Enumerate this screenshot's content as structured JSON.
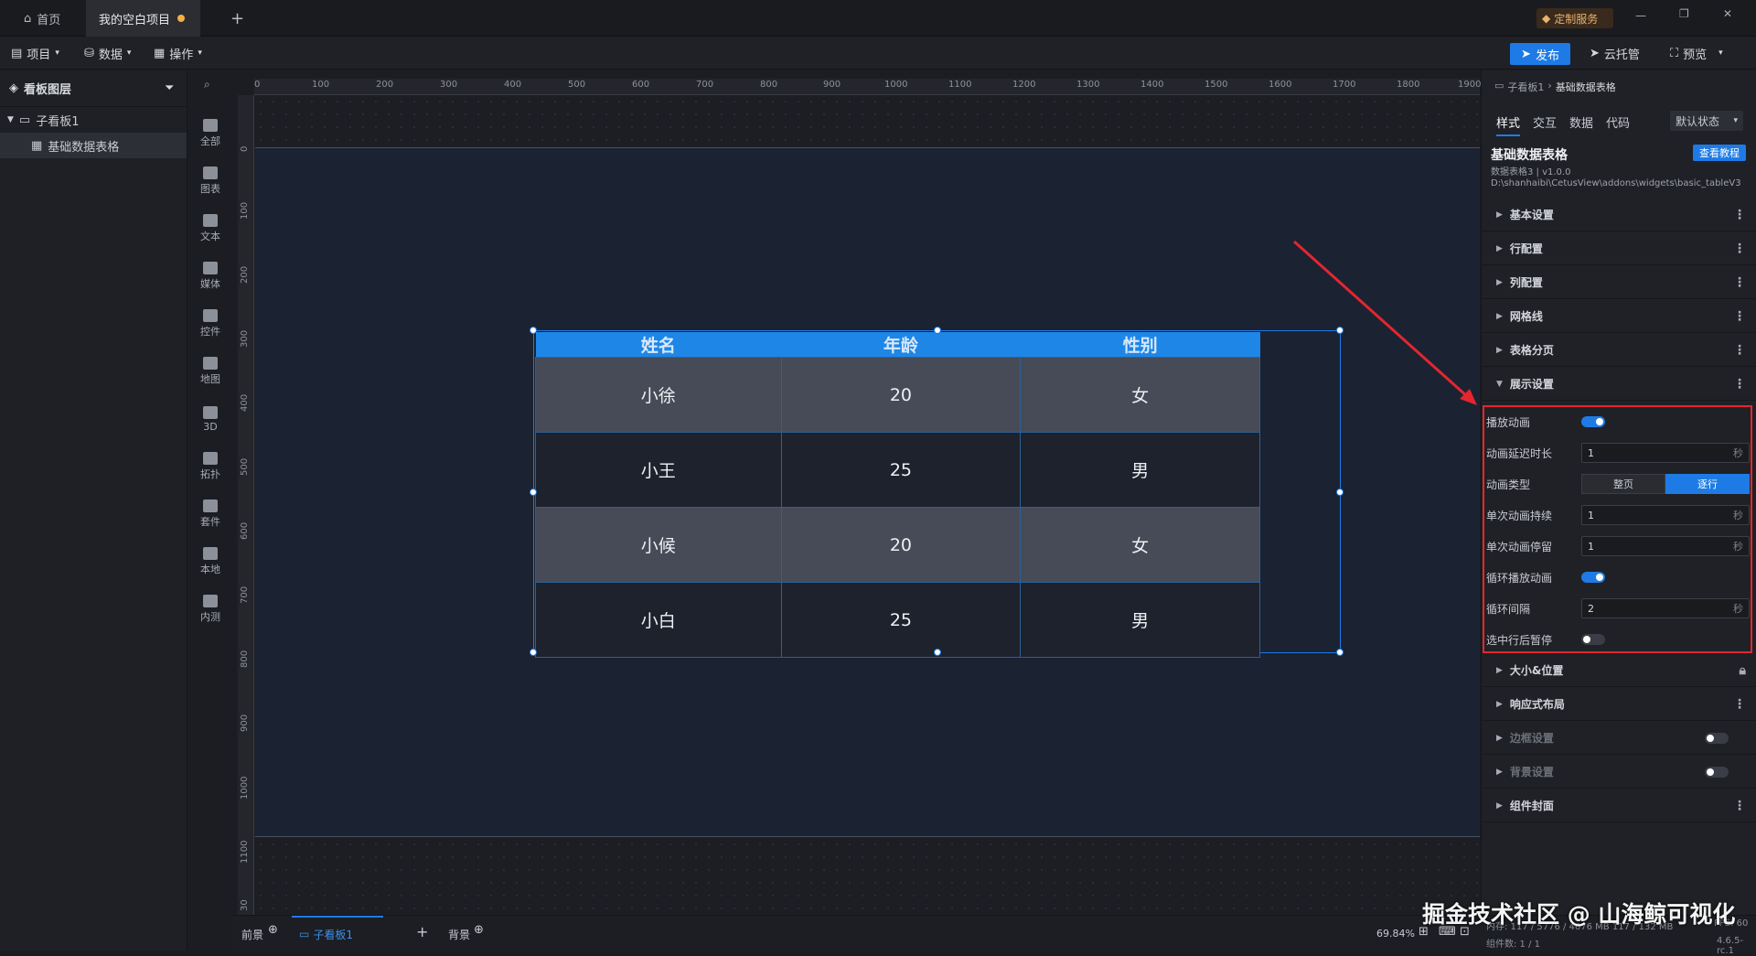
{
  "titlebar": {
    "tab_home": "首页",
    "tab_project": "我的空白项目",
    "custom_service": "定制服务"
  },
  "menubar": {
    "project": "项目",
    "data": "数据",
    "operate": "操作",
    "publish": "发布",
    "cloud": "云托管",
    "preview": "预览"
  },
  "layers": {
    "title": "看板图层",
    "items": [
      "子看板1",
      "基础数据表格"
    ]
  },
  "toolbox": [
    "全部",
    "图表",
    "文本",
    "媒体",
    "控件",
    "地图",
    "3D",
    "拓扑",
    "套件",
    "本地",
    "内测"
  ],
  "ruler": {
    "top": [
      "0",
      "100",
      "200",
      "300",
      "400",
      "500",
      "600",
      "700",
      "800",
      "900",
      "1000",
      "1100",
      "1200",
      "1300",
      "1400",
      "1500",
      "1600",
      "1700",
      "1800",
      "1900"
    ],
    "left": [
      "0",
      "100",
      "200",
      "300",
      "400",
      "500",
      "600",
      "700",
      "800",
      "900",
      "1000",
      "1100",
      "30"
    ]
  },
  "table": {
    "headers": [
      "姓名",
      "年龄",
      "性别"
    ],
    "rows": [
      [
        "小徐",
        "20",
        "女"
      ],
      [
        "小王",
        "25",
        "男"
      ],
      [
        "小候",
        "20",
        "女"
      ],
      [
        "小白",
        "25",
        "男"
      ]
    ]
  },
  "rightpanel": {
    "breadcrumb_parent": "子看板1",
    "breadcrumb_current": "基础数据表格",
    "tabs": [
      "样式",
      "交互",
      "数据",
      "代码"
    ],
    "state_select": "默认状态",
    "widget_title": "基础数据表格",
    "tutorial_button": "查看教程",
    "widget_version": "数据表格3 | v1.0.0",
    "widget_path": "D:\\shanhaibi\\CetusView\\addons\\widgets\\basic_tableV3",
    "sections_top": [
      "基本设置",
      "行配置",
      "列配置",
      "网格线",
      "表格分页",
      "展示设置"
    ],
    "props": {
      "play_anim": "播放动画",
      "anim_delay": "动画延迟时长",
      "anim_delay_value": "1",
      "anim_type": "动画类型",
      "anim_type_opt1": "整页",
      "anim_type_opt2": "逐行",
      "single_duration": "单次动画持续",
      "single_duration_value": "1",
      "single_stay": "单次动画停留",
      "single_stay_value": "1",
      "loop_anim": "循环播放动画",
      "loop_interval": "循环间隔",
      "loop_interval_value": "2",
      "pause_on_select": "选中行后暂停",
      "unit": "秒"
    },
    "sections_bottom": [
      "大小&位置",
      "响应式布局",
      "边框设置",
      "背景设置",
      "组件封面"
    ]
  },
  "bottombar": {
    "foreground": "前景",
    "board_tab": "子看板1",
    "background": "背景",
    "zoom": "69.84%",
    "perf": "内存: 117 / 5776 / 4676 MB 117 / 132 MB",
    "fps": "FPS: 60",
    "component_count": "组件数: 1 / 1",
    "version": "4.6.5-rc.1"
  },
  "watermark": "掘金技术社区 @ 山海鲸可视化"
}
